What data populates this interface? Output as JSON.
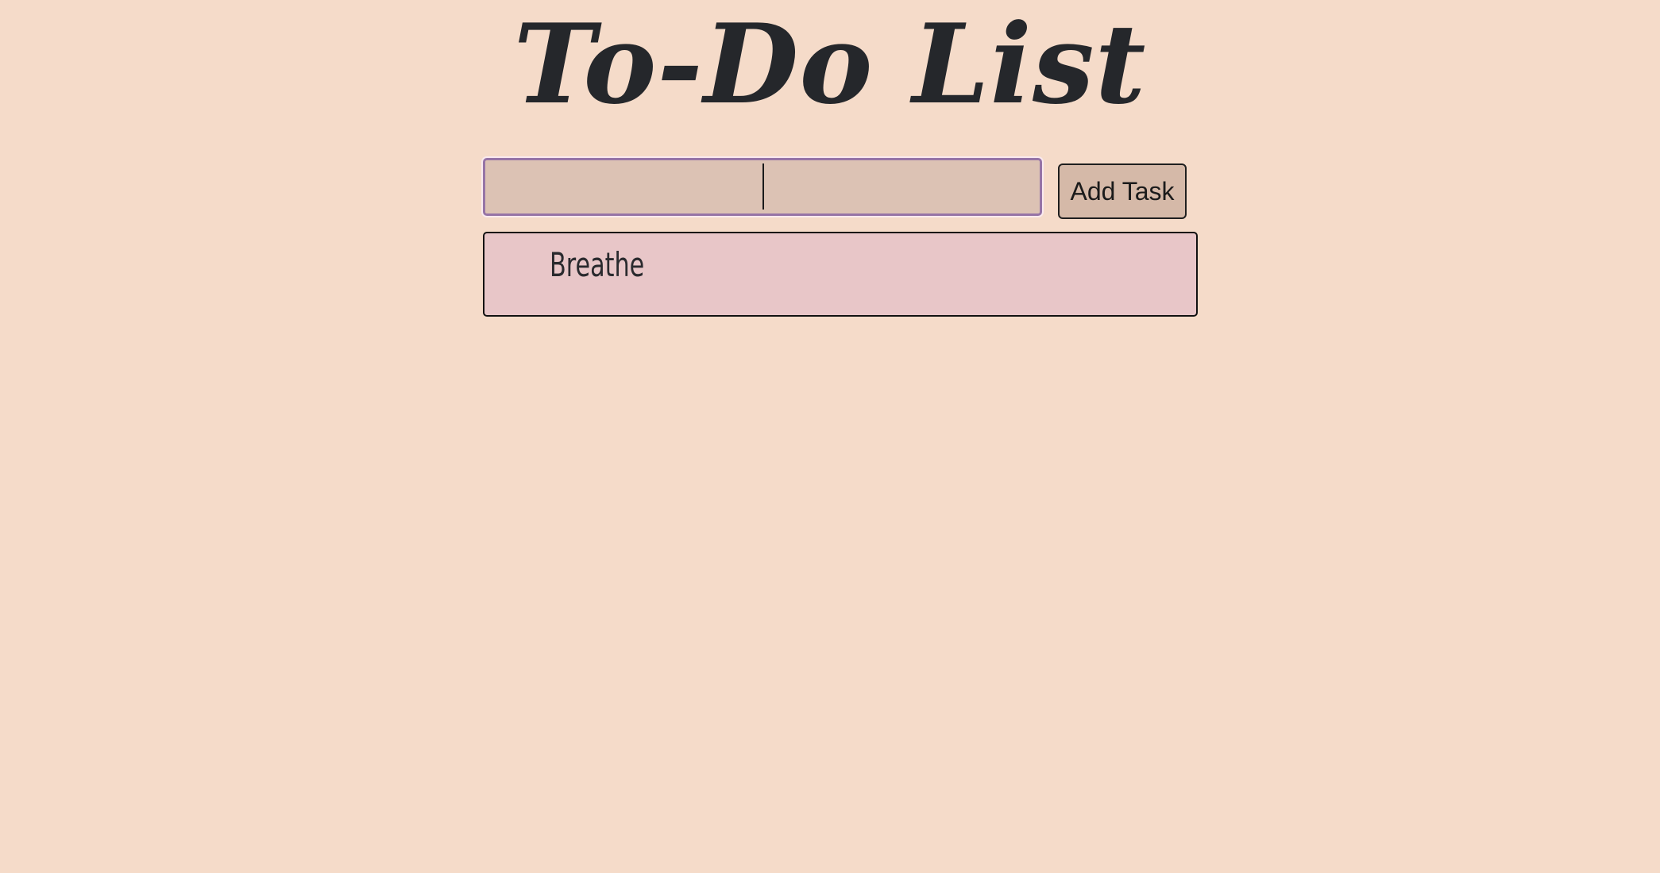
{
  "header": {
    "title": "To-Do List"
  },
  "form": {
    "input_value": "",
    "input_placeholder": "",
    "add_button_label": "Add Task"
  },
  "tasks": [
    {
      "label": "Breathe"
    }
  ],
  "colors": {
    "background": "#f5dbc9",
    "input_background": "#dcc2b4",
    "input_focus_border": "#9674a6",
    "button_background": "#d5b9a8",
    "list_background": "#e8c6c8",
    "text": "#25272b"
  }
}
